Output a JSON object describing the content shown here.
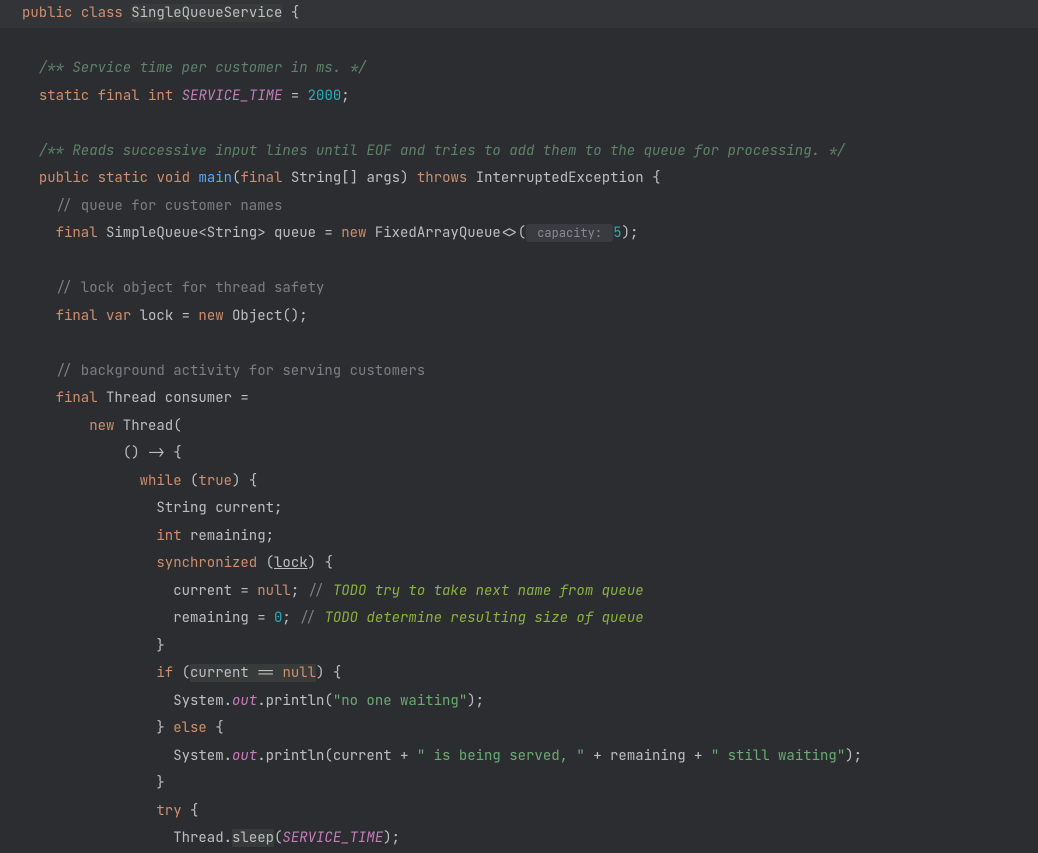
{
  "colors": {
    "background": "#2b2d30",
    "keyword": "#cf8e6d",
    "docComment": "#5f826b",
    "lineComment": "#7a7e85",
    "todoComment": "#8bb33d",
    "staticField": "#c77dbb",
    "number": "#2aacb8",
    "string": "#6aab73",
    "methodDecl": "#56a8f5",
    "highlight": "#373b39"
  },
  "l1": {
    "public": "public",
    "class": "class",
    "className": "SingleQueueService",
    "brace": " {"
  },
  "l3": {
    "comment": "/** Service time per customer in ms. */"
  },
  "l4": {
    "static": "static",
    "final": "final",
    "int": "int",
    "name": "SERVICE_TIME",
    "eq": " = ",
    "val": "2000",
    "semi": ";"
  },
  "l6": {
    "comment": "/** Reads successive input lines until EOF and tries to add them to the queue for processing. */"
  },
  "l7": {
    "public": "public",
    "static": "static",
    "void": "void",
    "main": "main",
    "open": "(",
    "final": "final",
    "stringArr": " String[] ",
    "args": "args",
    "close": ") ",
    "throws": "throws",
    "exc": " InterruptedException ",
    "brace": "{"
  },
  "l8": {
    "comment": "// queue for customer names"
  },
  "l9": {
    "final": "final",
    "type": " SimpleQueue<String> ",
    "var": "queue",
    "eq": " = ",
    "new": "new",
    "ctor": " FixedArrayQueue<>(",
    "hint": " capacity: ",
    "val": "5",
    "end": ");"
  },
  "l11": {
    "comment": "// lock object for thread safety"
  },
  "l12": {
    "final": "final",
    "var_kw": "var",
    "name": " lock = ",
    "new": "new",
    "ctor": " Object()",
    "semi": ";"
  },
  "l14": {
    "comment": "// background activity for serving customers"
  },
  "l15": {
    "final": "final",
    "rest": " Thread consumer ="
  },
  "l16": {
    "new": "new",
    "rest": " Thread("
  },
  "l17": {
    "txt": "() -> {"
  },
  "l18": {
    "while": "while",
    "open": " (",
    "true": "true",
    "close": ") {"
  },
  "l19": {
    "type": "String ",
    "name": "current",
    "semi": ";"
  },
  "l20": {
    "int": "int",
    "name": " remaining",
    "semi": ";"
  },
  "l21": {
    "sync": "synchronized",
    "open": " (",
    "lock": "lock",
    "close": ") {"
  },
  "l22": {
    "lhs": "current = ",
    "null": "null",
    "semi": "; ",
    "slash": "// ",
    "todo": "TODO try to take next name from queue"
  },
  "l23": {
    "lhs": "remaining = ",
    "zero": "0",
    "semi": "; ",
    "slash": "// ",
    "todo": "TODO determine resulting size of queue"
  },
  "l24": {
    "brace": "}"
  },
  "l25": {
    "if": "if",
    "open": " (",
    "expr_l": "current == ",
    "null": "null",
    "close": ") {"
  },
  "l26": {
    "sys": "System.",
    "out": "out",
    "print": ".println(",
    "str": "\"no one waiting\"",
    "end": ");"
  },
  "l27": {
    "cb": "} ",
    "else": "else",
    "ob": " {"
  },
  "l28": {
    "sys": "System.",
    "out": "out",
    "print": ".println(current + ",
    "s1": "\" is being served, \"",
    "mid": " + remaining + ",
    "s2": "\" still waiting\"",
    "end": ");"
  },
  "l29": {
    "brace": "}"
  },
  "l30": {
    "try": "try",
    "ob": " {"
  },
  "l31": {
    "thread": "Thread.",
    "sleep": "sleep",
    "open": "(",
    "arg": "SERVICE_TIME",
    "end": ");"
  }
}
